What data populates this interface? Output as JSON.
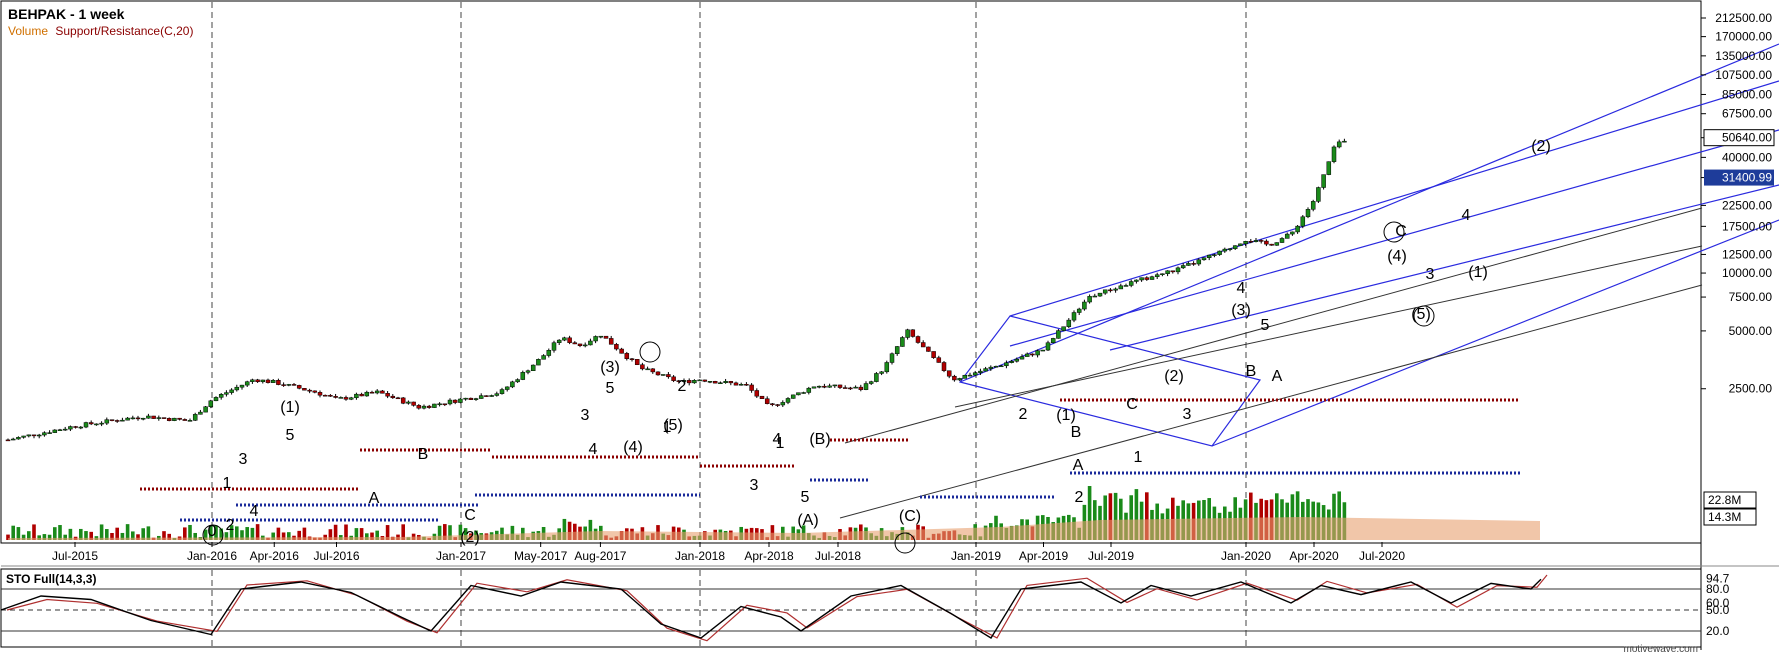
{
  "header": {
    "title": "BEHPAK - 1 week",
    "legend_volume": "Volume",
    "legend_sr": "Support/Resistance(C,20)"
  },
  "indicator": {
    "title": "STO Full(14,3,3)",
    "ticks": [
      "94.7",
      "80.0",
      "60.0",
      "50.0",
      "20.0"
    ]
  },
  "watermark": "motivewave.com",
  "colors": {
    "up": "#1a8a1a",
    "down": "#b00000",
    "channel": "#2a2adf",
    "resistance": "#8b0000",
    "support": "#1a2a9a",
    "volume_avg": "#e8a070",
    "stoch_k": "#000000",
    "stoch_d": "#b03030",
    "price_badge": "#1e3c9a"
  },
  "chart_data": {
    "type": "candlestick",
    "title": "BEHPAK - 1 week",
    "scale": "log",
    "ylim": [
      900,
      250000
    ],
    "y_ticks": [
      "212500.00",
      "170000.00",
      "135000.00",
      "107500.00",
      "85000.00",
      "67500.00",
      "50640.00",
      "40000.00",
      "31400.99",
      "22500.00",
      "17500.00",
      "12500.00",
      "10000.00",
      "7500.00",
      "5000.00",
      "2500.00",
      "22.8M",
      "14.3M"
    ],
    "y_tick_values": [
      212500,
      170000,
      135000,
      107500,
      85000,
      67500,
      50640,
      40000,
      31400.99,
      22500,
      17500,
      12500,
      10000,
      7500,
      5000,
      2500
    ],
    "x_ticks": [
      "Jul-2015",
      "Jan-2016",
      "Apr-2016",
      "Jul-2016",
      "Jan-2017",
      "May-2017",
      "Aug-2017",
      "Jan-2018",
      "Apr-2018",
      "Jul-2018",
      "Jan-2019",
      "Apr-2019",
      "Jul-2019",
      "Jan-2020",
      "Apr-2020",
      "Jul-2020"
    ],
    "year_lines": [
      "Jan-2016",
      "Jan-2017",
      "Jan-2018",
      "Jan-2019",
      "Jan-2020"
    ],
    "last_price": "50640.00",
    "marker_price": "31400.99",
    "volume_ticks": [
      "22.8M",
      "14.3M"
    ],
    "series": [
      {
        "name": "",
        "dates": [
          "2015-04",
          "2015-07",
          "2015-10",
          "2015-12",
          "2016-01",
          "2016-03",
          "2016-04",
          "2016-06",
          "2016-07",
          "2016-09",
          "2016-11",
          "2017-01",
          "2017-03",
          "2017-05",
          "2017-06",
          "2017-07",
          "2017-08",
          "2017-10",
          "2017-12",
          "2018-01",
          "2018-03",
          "2018-04",
          "2018-06",
          "2018-08",
          "2018-09",
          "2018-10",
          "2018-12",
          "2019-02",
          "2019-04",
          "2019-06",
          "2019-08",
          "2019-10",
          "2019-12",
          "2020-01",
          "2020-02",
          "2020-03",
          "2020-04",
          "2020-05"
        ],
        "close": [
          1350,
          1600,
          1800,
          1700,
          2200,
          2800,
          2700,
          2400,
          2200,
          2400,
          2000,
          2200,
          2400,
          3600,
          4600,
          4200,
          4800,
          3200,
          2700,
          2800,
          2600,
          2000,
          2600,
          2500,
          3200,
          5000,
          2800,
          3300,
          4000,
          7500,
          9000,
          10500,
          13000,
          15000,
          14000,
          16000,
          24000,
          48000
        ]
      }
    ],
    "annotations": [
      "(1)",
      "5",
      "3",
      "1",
      "4",
      "2",
      "0",
      "B",
      "A",
      "C",
      "(2)",
      "(3)",
      "5",
      "3",
      "4",
      "(4)",
      "(5)",
      "1",
      "2",
      "1",
      "(B)",
      "4",
      "3",
      "5",
      "(A)",
      "(C)",
      "2",
      "(1)",
      "B",
      "A",
      "C",
      "1",
      "2",
      "(2)",
      "3",
      "4",
      "(3)",
      "5",
      "B",
      "A",
      "C",
      "(4)",
      "3",
      "(5)",
      "4",
      "(1)",
      "(2)",
      "(3)"
    ]
  }
}
